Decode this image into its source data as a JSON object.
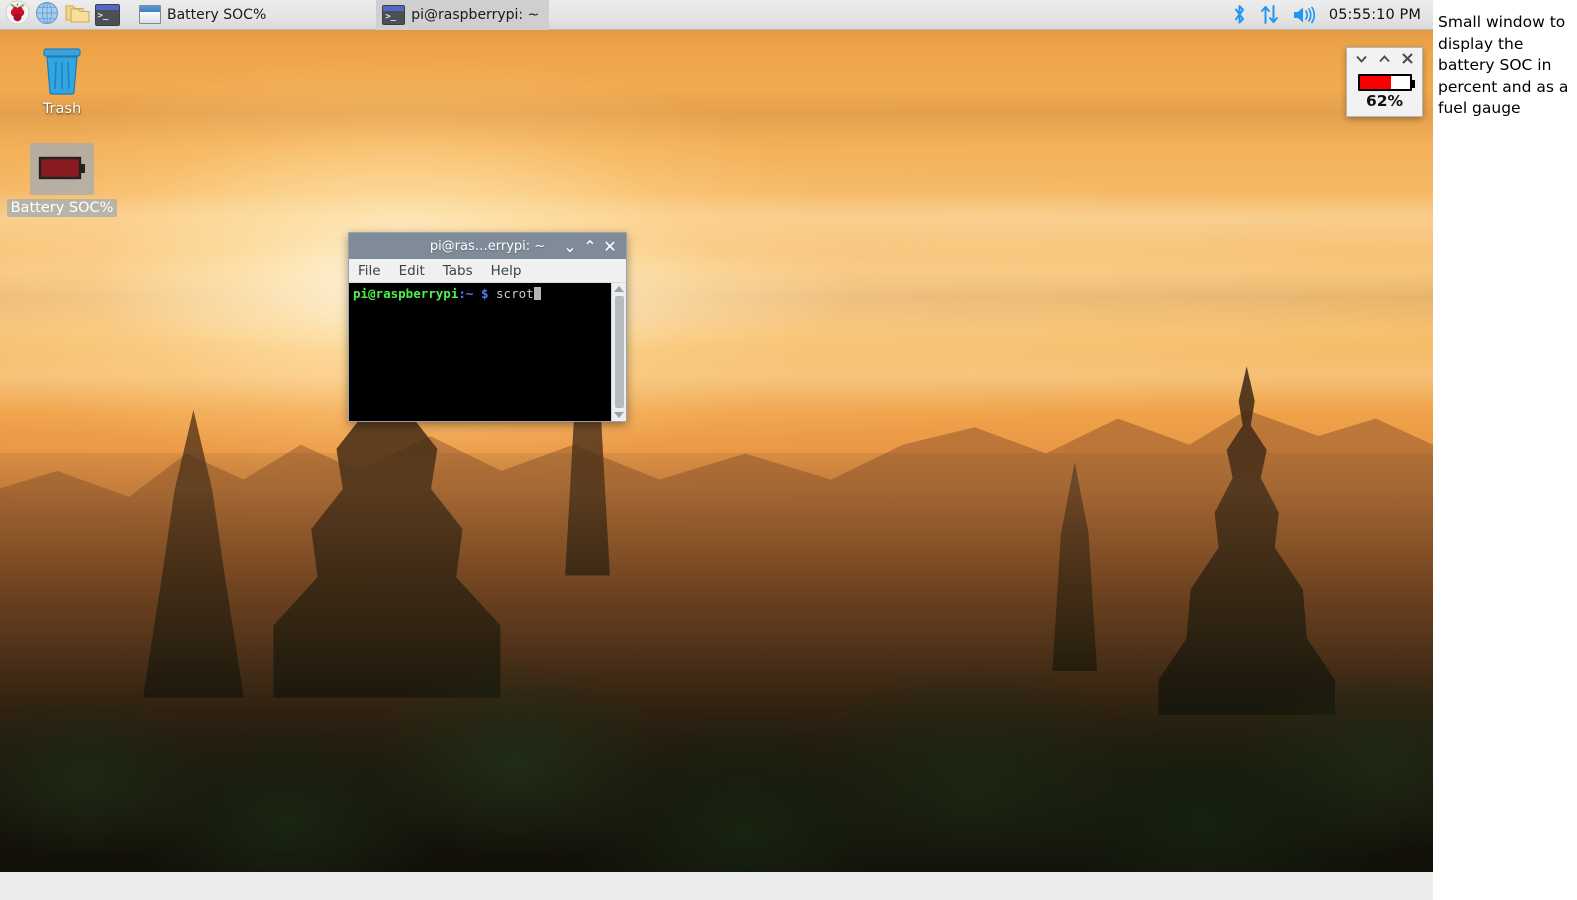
{
  "taskbar": {
    "launchers": [
      {
        "name": "raspberry-menu",
        "icon": "raspberry-icon",
        "tooltip": "Menu"
      },
      {
        "name": "web-browser",
        "icon": "globe-icon",
        "tooltip": "Web Browser"
      },
      {
        "name": "file-manager",
        "icon": "folder-icon",
        "tooltip": "File Manager"
      },
      {
        "name": "terminal-launcher",
        "icon": "terminal-icon",
        "tooltip": "Terminal"
      }
    ],
    "windows": [
      {
        "label": "Battery SOC%",
        "icon": "window-icon",
        "active": false
      },
      {
        "label": "pi@raspberrypi: ~",
        "icon": "terminal-icon",
        "active": true
      }
    ],
    "tray": [
      {
        "name": "bluetooth-icon",
        "label": "Bluetooth"
      },
      {
        "name": "network-icon",
        "label": "Network"
      },
      {
        "name": "volume-icon",
        "label": "Volume"
      }
    ],
    "clock": "05:55:10 PM"
  },
  "desktop_icons": [
    {
      "label": "Trash",
      "icon": "trash-icon",
      "selected": false
    },
    {
      "label": "Battery SOC%",
      "icon": "battery-icon",
      "selected": true
    }
  ],
  "terminal": {
    "title": "pi@ras…errypi: ~",
    "menu": [
      "File",
      "Edit",
      "Tabs",
      "Help"
    ],
    "controls": {
      "minimize": "⌄",
      "maximize": "⌃",
      "close": "✕"
    },
    "prompt": {
      "user_host": "pi@raspberrypi",
      "path": ":~",
      "symbol": "$",
      "command": "scrot"
    }
  },
  "battery_window": {
    "title": "",
    "controls": {
      "minimize": "⌄",
      "maximize": "⌃",
      "close": "✕"
    },
    "percent_label": "62%",
    "percent_value": 62,
    "fill_color": "#fb0000",
    "empty_color": "#ffffff"
  },
  "annotation": {
    "text": "Small window to display the battery SOC in percent and as a fuel gauge"
  }
}
